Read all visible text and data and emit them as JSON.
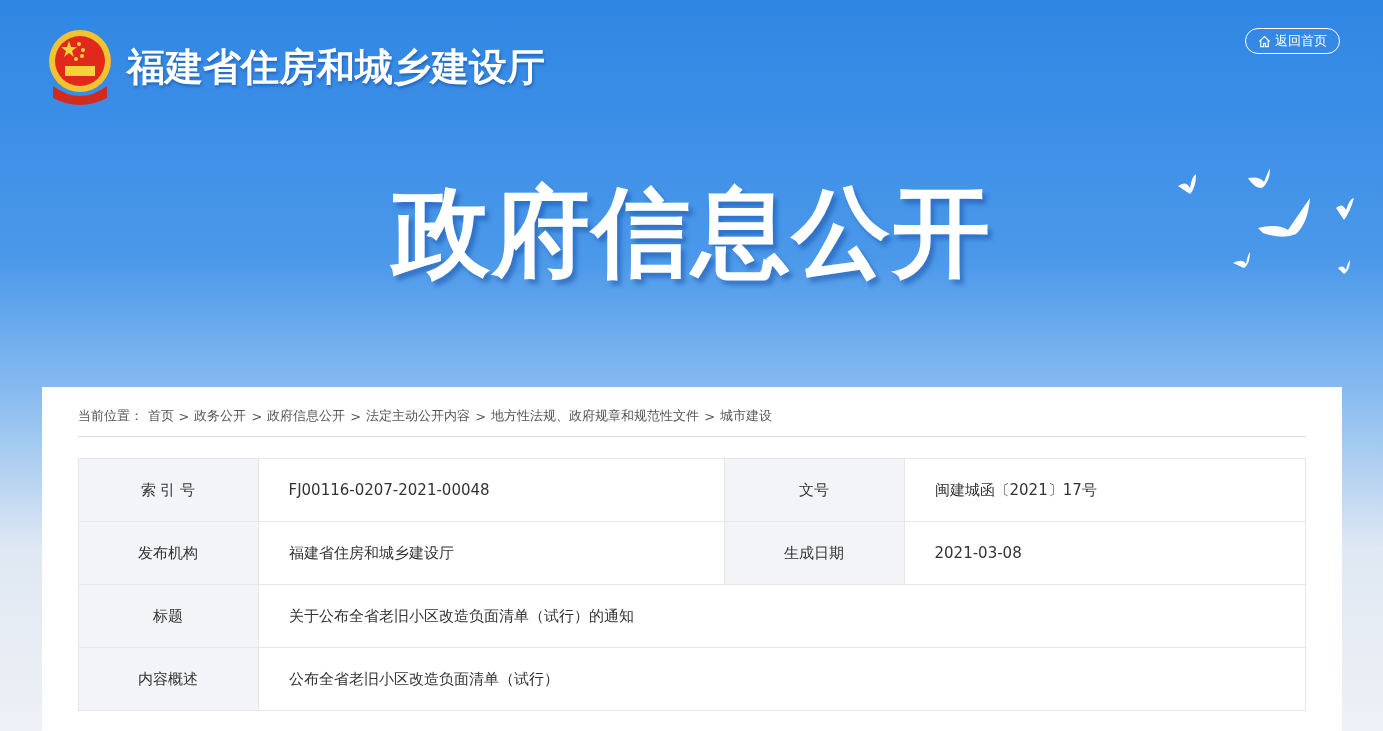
{
  "site": {
    "title": "福建省住房和城乡建设厅",
    "home_button": "返回首页"
  },
  "banner": {
    "title": "政府信息公开"
  },
  "breadcrumb": {
    "label": "当前位置：",
    "separator": ">",
    "items": [
      "首页",
      "政务公开",
      "政府信息公开",
      "法定主动公开内容",
      "地方性法规、政府规章和规范性文件",
      "城市建设"
    ]
  },
  "info_table": {
    "rows": [
      {
        "cells": [
          {
            "label": "索 引 号",
            "value": "FJ00116-0207-2021-00048"
          },
          {
            "label": "文号",
            "value": "闽建城函〔2021〕17号"
          }
        ]
      },
      {
        "cells": [
          {
            "label": "发布机构",
            "value": "福建省住房和城乡建设厅"
          },
          {
            "label": "生成日期",
            "value": "2021-03-08"
          }
        ]
      },
      {
        "cells": [
          {
            "label": "标题",
            "value": "关于公布全省老旧小区改造负面清单（试行）的通知"
          }
        ]
      },
      {
        "cells": [
          {
            "label": "内容概述",
            "value": "公布全省老旧小区改造负面清单（试行）"
          }
        ]
      }
    ]
  }
}
